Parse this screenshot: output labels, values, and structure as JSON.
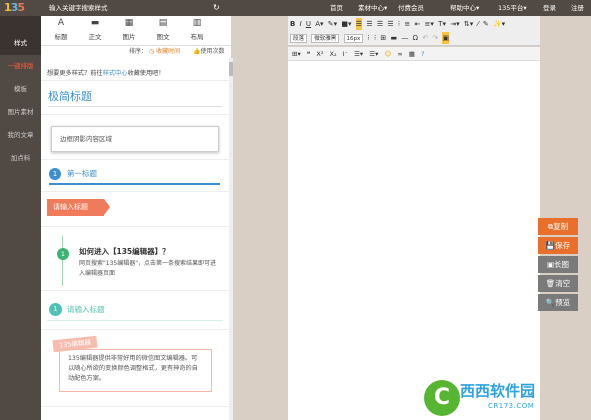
{
  "header": {
    "logo": [
      "1",
      "3",
      "5"
    ],
    "search_placeholder": "输入关键字搜索样式",
    "refresh_icon": "↻",
    "nav": [
      "首页",
      "素材中心▾",
      "付费会员",
      "帮助中心▾",
      "135平台▾",
      "登录",
      "注册"
    ]
  },
  "sidebar": {
    "items": [
      "样式",
      "一键排版",
      "模板",
      "图片素材",
      "我的文章",
      "加点料"
    ]
  },
  "tools": {
    "items": [
      {
        "label": "标题",
        "icon": "A"
      },
      {
        "label": "正文",
        "icon": "▬"
      },
      {
        "label": "图片",
        "icon": "▦"
      },
      {
        "label": "图文",
        "icon": "▤"
      },
      {
        "label": "布局",
        "icon": "▥"
      }
    ]
  },
  "sortbar": {
    "label": "排序：",
    "by_time": "◷ 收藏时间",
    "by_use": "👍使用次数"
  },
  "styles": {
    "more_prefix": "想要更多样式？前往",
    "more_link": "样式中心",
    "more_suffix": "收藏使用吧！",
    "simple_title": "极简标题",
    "shadow_box": "边框阴影内容区域",
    "num1": "1",
    "first_title": "第一标题",
    "orange_tag": "请输入标题",
    "q_num": "1",
    "q_title": "如何进入【135编辑器】？",
    "q_body": "网页搜索\"135编辑器\"，点击第一条搜索结果即可进入编辑器页面",
    "teal_num": "1",
    "teal_title": "请输入标题",
    "pink_tag": "135编辑器",
    "pink_body": "135编辑器提供非常好用的微信图文编辑器。可以随心所欲的变换颜色调整格式，更有神奇的自动配色方案。"
  },
  "editor": {
    "row1": [
      "B",
      "I",
      "U",
      "A▾",
      "✎▾",
      "■▾",
      "☰",
      "☰",
      "☰",
      "☰",
      "⁝",
      "≡",
      "⇤",
      "≡▾",
      "T▾",
      "⇥▾",
      "⇅▾",
      "⁄",
      "✎",
      "✨▾"
    ],
    "paragraph": "段落",
    "font": "微软雅黑",
    "size": "16px",
    "row2b": [
      "⁝",
      "⁝",
      "⊞",
      "▬",
      "—",
      "Ω",
      "↶",
      "↷",
      "▣"
    ],
    "sub": [
      "⊞▾",
      "❝",
      "Ⅹ²",
      "X₂",
      "I⁻",
      "☰▾",
      "☰▾",
      "☺",
      "∞",
      "▦",
      "?"
    ]
  },
  "actions": {
    "copy": "⧉复制",
    "save": "💾保存",
    "long_image": "▣长图",
    "clear": "🗑清空",
    "preview": "🔍预览"
  },
  "watermark": {
    "mark": "C",
    "title": "西西软件园",
    "url": "CR173.COM"
  }
}
